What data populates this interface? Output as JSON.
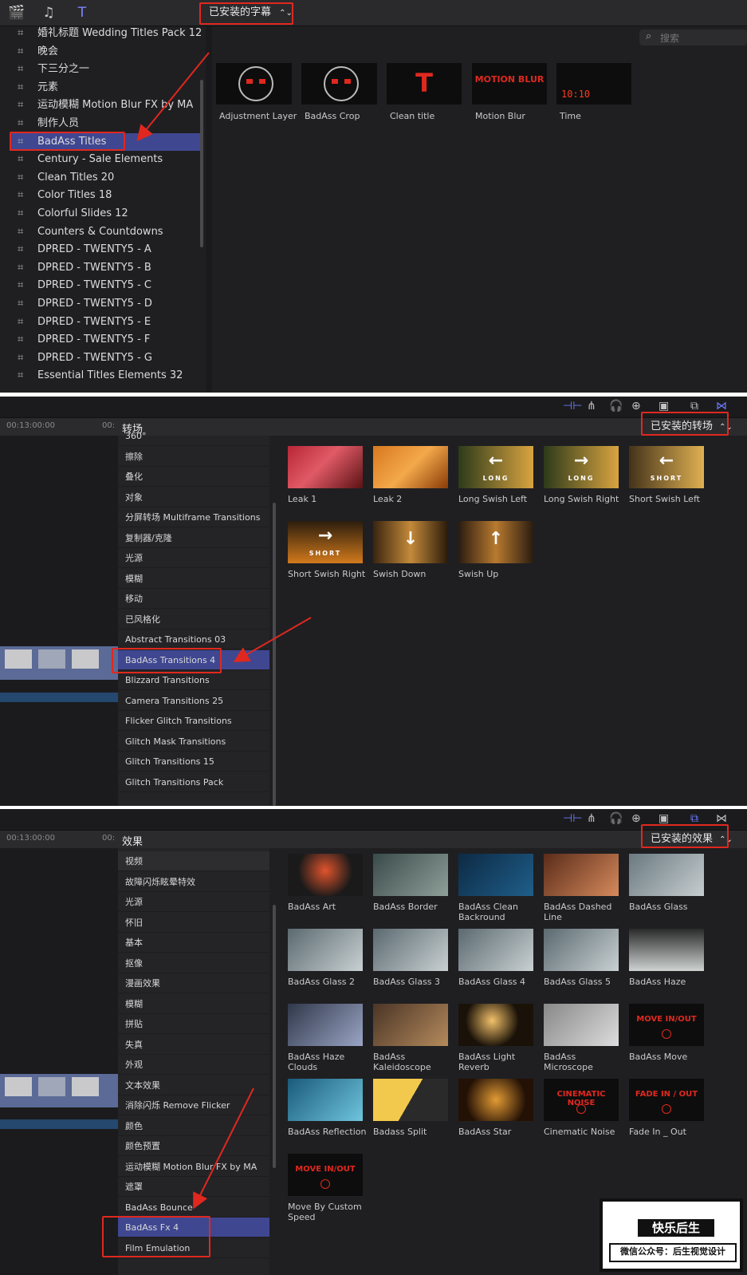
{
  "panel1": {
    "selector": "已安装的字幕",
    "search_placeholder": "搜索",
    "library": [
      "婚礼标题 Wedding Titles Pack 12",
      "晚会",
      "下三分之一",
      "元素",
      "运动模糊 Motion Blur FX by MA",
      "制作人员",
      "BadAss Titles",
      "Century - Sale Elements",
      "Clean Titles 20",
      "Color Titles 18",
      "Colorful Slides 12",
      "Counters & Countdowns",
      "DPRED - TWENTY5 - A",
      "DPRED - TWENTY5 - B",
      "DPRED - TWENTY5 - C",
      "DPRED - TWENTY5 - D",
      "DPRED - TWENTY5 - E",
      "DPRED - TWENTY5 - F",
      "DPRED - TWENTY5 - G",
      "Essential Titles Elements 32"
    ],
    "selected_index": 6,
    "items": [
      {
        "label": "Adjustment Layer",
        "thumb": "Adjustment Layer"
      },
      {
        "label": "BadAss Crop",
        "thumb": "BadAss Crop"
      },
      {
        "label": "Clean title",
        "thumb_text": "T"
      },
      {
        "label": "Motion Blur",
        "thumb_text": "MOTION BLUR"
      },
      {
        "label": "Time",
        "thumb_text": "10:10"
      }
    ]
  },
  "panel2": {
    "timecode": "00:13:00:00",
    "timecode2": "00:",
    "category_title": "转场",
    "selector": "已安装的转场",
    "categories": [
      "360°",
      "擦除",
      "叠化",
      "对象",
      "分屏转场 Multiframe Transitions",
      "复制器/克隆",
      "光源",
      "模糊",
      "移动",
      "已风格化",
      "Abstract Transitions 03",
      "BadAss Transitions 4",
      "Blizzard Transitions",
      "Camera Transitions 25",
      "Flicker Glitch Transitions",
      "Glitch Mask Transitions",
      "Glitch Transitions 15",
      "Glitch Transitions Pack"
    ],
    "selected_index": 11,
    "items": [
      {
        "label": "Leak 1"
      },
      {
        "label": "Leak 2"
      },
      {
        "label": "Long Swish Left",
        "arrow": "←",
        "tag": "LONG"
      },
      {
        "label": "Long Swish Right",
        "arrow": "→",
        "tag": "LONG"
      },
      {
        "label": "Short Swish Left",
        "arrow": "←",
        "tag": "SHORT"
      },
      {
        "label": "Short Swish Right",
        "arrow": "→",
        "tag": "SHORT"
      },
      {
        "label": "Swish Down",
        "arrow": "↓"
      },
      {
        "label": "Swish Up",
        "arrow": "↑"
      }
    ]
  },
  "panel3": {
    "timecode": "00:13:00:00",
    "timecode2": "00:",
    "category_title": "效果",
    "selector": "已安装的效果",
    "categories": [
      "视频",
      "故障闪烁眩晕特效",
      "光源",
      "怀旧",
      "基本",
      "抠像",
      "漫画效果",
      "模糊",
      "拼贴",
      "失真",
      "外观",
      "文本效果",
      "消除闪烁 Remove Flicker",
      "颜色",
      "颜色预置",
      "运动模糊 Motion Blur FX by MA",
      "遮罩",
      "BadAss Bounce",
      "BadAss Fx 4",
      "Film Emulation"
    ],
    "selected_index": 18,
    "items": [
      {
        "label": "BadAss Art"
      },
      {
        "label": "BadAss Border"
      },
      {
        "label": "BadAss Clean Backround"
      },
      {
        "label": "BadAss Dashed Line"
      },
      {
        "label": "BadAss Glass"
      },
      {
        "label": "BadAss Glass 2"
      },
      {
        "label": "BadAss Glass 3"
      },
      {
        "label": "BadAss Glass 4"
      },
      {
        "label": "BadAss Glass 5"
      },
      {
        "label": "BadAss Haze"
      },
      {
        "label": "BadAss Haze Clouds"
      },
      {
        "label": "BadAss Kaleidoscope"
      },
      {
        "label": "BadAss Light Reverb"
      },
      {
        "label": "BadAss Microscope"
      },
      {
        "label": "BadAss Move",
        "thumb_text": "MOVE IN/OUT"
      },
      {
        "label": "BadAss Reflection"
      },
      {
        "label": "Badass Split"
      },
      {
        "label": "BadAss Star"
      },
      {
        "label": "Cinematic Noise",
        "thumb_text": "CINEMATIC NOISE"
      },
      {
        "label": "Fade In _ Out",
        "thumb_text": "FADE IN / OUT"
      },
      {
        "label": "Move By Custom Speed",
        "thumb_text": "MOVE IN/OUT"
      }
    ]
  },
  "watermark": {
    "line1": "快乐后生",
    "line2": "微信公众号：后生视觉设计"
  },
  "colors": {
    "selection": "#3f4791",
    "highlight": "#e0281f",
    "accent": "#6e7cff"
  }
}
